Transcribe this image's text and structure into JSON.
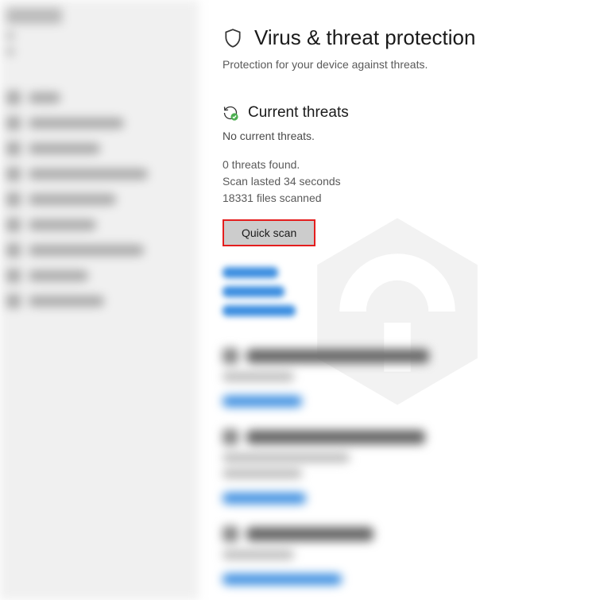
{
  "header": {
    "title": "Virus & threat protection",
    "subtitle": "Protection for your device against threats."
  },
  "current_threats": {
    "title": "Current threats",
    "status": "No current threats.",
    "threats_found": "0 threats found.",
    "scan_duration": "Scan lasted 34 seconds",
    "files_scanned": "18331 files scanned",
    "quick_scan_label": "Quick scan"
  }
}
